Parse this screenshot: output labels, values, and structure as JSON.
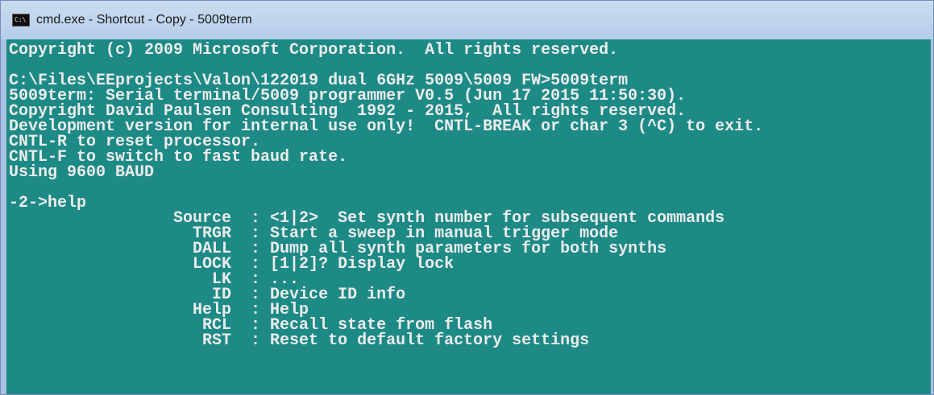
{
  "window": {
    "title": "cmd.exe - Shortcut - Copy - 5009term",
    "icon_label": "C:\\"
  },
  "console": {
    "lines": [
      "Copyright (c) 2009 Microsoft Corporation.  All rights reserved.",
      "",
      "C:\\Files\\EEprojects\\Valon\\122019 dual 6GHz 5009\\5009 FW>5009term",
      "5009term: Serial terminal/5009 programmer V0.5 (Jun 17 2015 11:50:30).",
      "Copyright David Paulsen Consulting  1992 - 2015,  All rights reserved.",
      "Development version for internal use only!  CNTL-BREAK or char 3 (^C) to exit.",
      "CNTL-R to reset processor.",
      "CNTL-F to switch to fast baud rate.",
      "Using 9600 BAUD",
      "",
      "-2->help",
      "                 Source  : <1|2>  Set synth number for subsequent commands",
      "                   TRGR  : Start a sweep in manual trigger mode",
      "                   DALL  : Dump all synth parameters for both synths",
      "                   LOCK  : [1|2]? Display lock",
      "                     LK  : ...",
      "                     ID  : Device ID info",
      "                   Help  : Help",
      "                    RCL  : Recall state from flash",
      "                    RST  : Reset to default factory settings"
    ]
  },
  "colors": {
    "console_background": "#1e8a86",
    "console_text": "#ececec",
    "titlebar": "#b6cde8"
  }
}
